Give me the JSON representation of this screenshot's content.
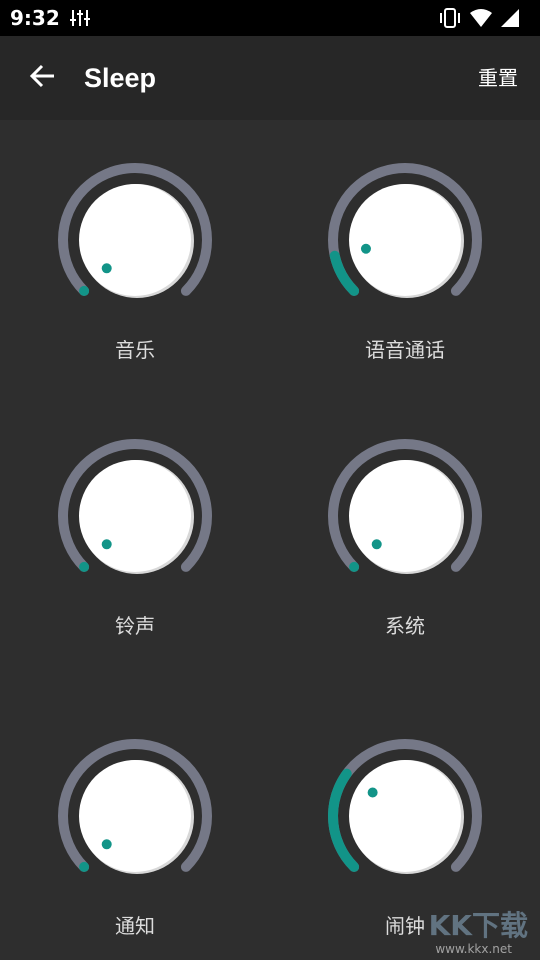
{
  "status": {
    "time": "9:32"
  },
  "header": {
    "title": "Sleep",
    "reset_label": "重置"
  },
  "colors": {
    "accent": "#129488",
    "track": "#757887",
    "knob": "#ffffff",
    "background": "#2e2e2e"
  },
  "knobs": [
    {
      "label": "音乐",
      "level": 0.0
    },
    {
      "label": "语音通话",
      "level": 0.12
    },
    {
      "label": "铃声",
      "level": 0.0
    },
    {
      "label": "系统",
      "level": 0.0
    },
    {
      "label": "通知",
      "level": 0.0
    },
    {
      "label": "闹钟",
      "level": 0.3
    }
  ],
  "watermark": {
    "logo": "KK下载",
    "url": "www.kkx.net"
  }
}
